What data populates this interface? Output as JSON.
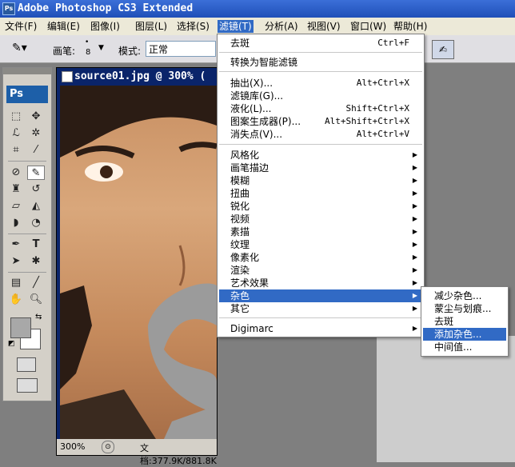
{
  "app": {
    "title": "Adobe Photoshop CS3 Extended",
    "badge": "Ps"
  },
  "menubar": [
    "文件(F)",
    "编辑(E)",
    "图像(I)",
    "图层(L)",
    "选择(S)",
    "滤镜(T)",
    "分析(A)",
    "视图(V)",
    "窗口(W)",
    "帮助(H)"
  ],
  "options": {
    "brush_label": "画笔:",
    "brush_size": "8",
    "mode_label": "模式:",
    "mode_value": "正常"
  },
  "toolbox": {
    "logo": "Ps"
  },
  "document": {
    "title": "source01.jpg @ 300% (",
    "zoom": "300%",
    "doc_info": "文档:377.9K/881.8K"
  },
  "filter_menu": {
    "items": [
      {
        "label": "去斑",
        "shortcut": "Ctrl+F"
      },
      {
        "label": "转换为智能滤镜",
        "shortcut": ""
      },
      {
        "label": "抽出(X)...",
        "shortcut": "Alt+Ctrl+X"
      },
      {
        "label": "滤镜库(G)...",
        "shortcut": ""
      },
      {
        "label": "液化(L)...",
        "shortcut": "Shift+Ctrl+X"
      },
      {
        "label": "图案生成器(P)...",
        "shortcut": "Alt+Shift+Ctrl+X"
      },
      {
        "label": "消失点(V)...",
        "shortcut": "Alt+Ctrl+V"
      },
      {
        "label": "风格化",
        "shortcut": ""
      },
      {
        "label": "画笔描边",
        "shortcut": ""
      },
      {
        "label": "模糊",
        "shortcut": ""
      },
      {
        "label": "扭曲",
        "shortcut": ""
      },
      {
        "label": "锐化",
        "shortcut": ""
      },
      {
        "label": "视频",
        "shortcut": ""
      },
      {
        "label": "素描",
        "shortcut": ""
      },
      {
        "label": "纹理",
        "shortcut": ""
      },
      {
        "label": "像素化",
        "shortcut": ""
      },
      {
        "label": "渲染",
        "shortcut": ""
      },
      {
        "label": "艺术效果",
        "shortcut": ""
      },
      {
        "label": "杂色",
        "shortcut": ""
      },
      {
        "label": "其它",
        "shortcut": ""
      },
      {
        "label": "Digimarc",
        "shortcut": ""
      }
    ]
  },
  "noise_submenu": {
    "items": [
      "减少杂色...",
      "蒙尘与划痕...",
      "去斑",
      "添加杂色...",
      "中间值..."
    ]
  },
  "colors": {
    "accent": "#316ac5",
    "title_bar": "#1f4fb8",
    "chrome": "#ece9d8"
  }
}
